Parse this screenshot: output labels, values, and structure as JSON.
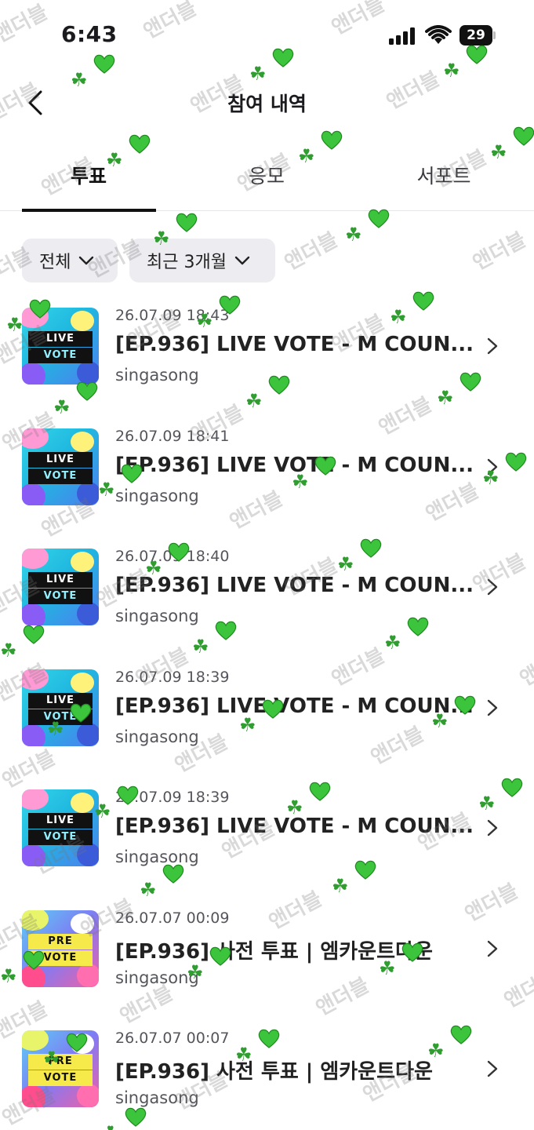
{
  "status_bar": {
    "time": "6:43",
    "battery": "29"
  },
  "header": {
    "title": "참여 내역"
  },
  "tabs": [
    {
      "label": "투표",
      "active": true
    },
    {
      "label": "응모",
      "active": false
    },
    {
      "label": "서포트",
      "active": false
    }
  ],
  "filters": {
    "all": "전체",
    "period": "최근 3개월"
  },
  "items": [
    {
      "date": "26.07.09 18:43",
      "title": "[EP.936] LIVE VOTE - M COUN...",
      "author": "singasong",
      "thumb_top": "LIVE",
      "thumb_bottom": "VOTE"
    },
    {
      "date": "26.07.09 18:41",
      "title": "[EP.936] LIVE VOTE - M COUN...",
      "author": "singasong",
      "thumb_top": "LIVE",
      "thumb_bottom": "VOTE"
    },
    {
      "date": "26.07.09 18:40",
      "title": "[EP.936] LIVE VOTE - M COUN...",
      "author": "singasong",
      "thumb_top": "LIVE",
      "thumb_bottom": "VOTE"
    },
    {
      "date": "26.07.09 18:39",
      "title": "[EP.936] LIVE VOTE - M COUN...",
      "author": "singasong",
      "thumb_top": "LIVE",
      "thumb_bottom": "VOTE"
    },
    {
      "date": "26.07.09 18:39",
      "title": "[EP.936] LIVE VOTE - M COUN...",
      "author": "singasong",
      "thumb_top": "LIVE",
      "thumb_bottom": "VOTE"
    },
    {
      "date": "26.07.07 00:09",
      "title": "[EP.936] 사전 투표 | 엠카운트다운",
      "author": "singasong",
      "thumb_top": "PRE",
      "thumb_bottom": "VOTE"
    },
    {
      "date": "26.07.07 00:07",
      "title": "[EP.936] 사전 투표 | 엠카운트다운",
      "author": "singasong",
      "thumb_top": "PRE",
      "thumb_bottom": "VOTE"
    }
  ],
  "watermark": {
    "text": "앤더블",
    "clover": "☘",
    "heart_color": "#3cc43c"
  }
}
